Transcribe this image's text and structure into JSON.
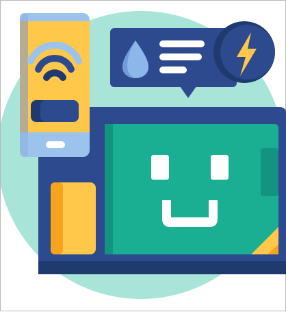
{
  "illustration": {
    "subject": "smart-device-illustration",
    "icons": [
      "wifi-icon",
      "water-drop-icon",
      "lightning-bolt-icon",
      "smiley-face-icon"
    ],
    "colors": {
      "background_circle": "#A8E4D8",
      "navy": "#2E4A8F",
      "navy_dark": "#1F3A6E",
      "phone_body": "#FFC84A",
      "phone_stripe": "#F6A31E",
      "phone_frame": "#9CC3EC",
      "screen_green": "#1AAE92",
      "screen_green_dark": "#139480",
      "face_white": "#FFFFFF",
      "drop_blue": "#8DB6EA",
      "bolt_yellow": "#FFC84A",
      "frame_border": "#B8B8B8"
    }
  }
}
